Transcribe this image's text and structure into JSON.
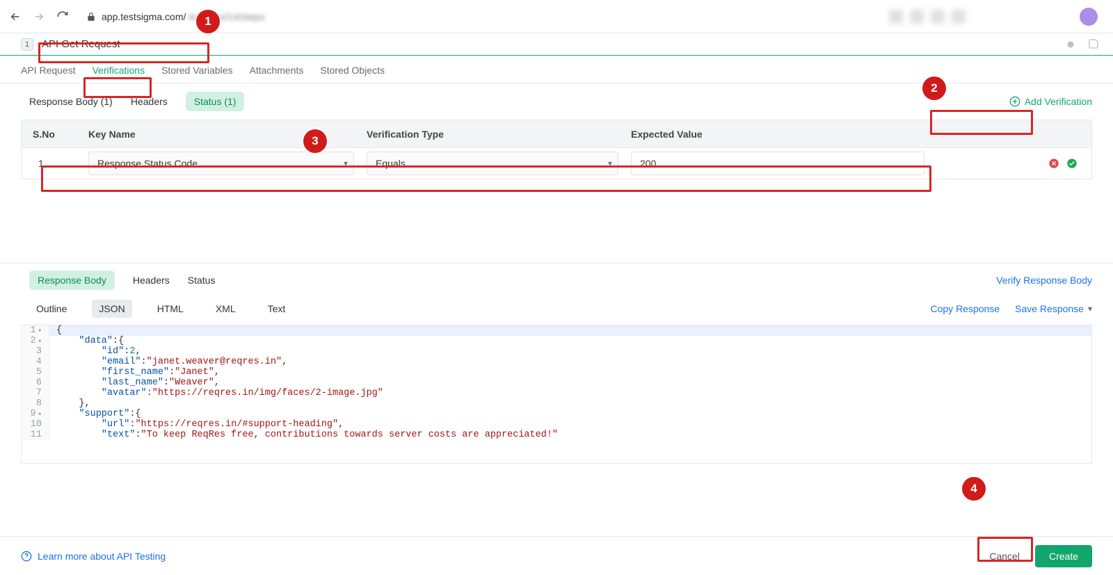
{
  "browser": {
    "url_host": "app.testsigma.com/",
    "url_rest": "..."
  },
  "title": {
    "number": "1",
    "value": "API Get Request"
  },
  "main_tabs": {
    "api_request": "API Request",
    "verifications": "Verifications",
    "stored_variables": "Stored Variables",
    "attachments": "Attachments",
    "stored_objects": "Stored Objects"
  },
  "sub_tabs": {
    "response_body": "Response Body (1)",
    "headers": "Headers",
    "status": "Status (1)"
  },
  "add_verification_label": "Add Verification",
  "table": {
    "headers": {
      "sno": "S.No",
      "key_name": "Key Name",
      "verification_type": "Verification Type",
      "expected_value": "Expected Value"
    },
    "row": {
      "sno": "1",
      "key_name": "Response Status Code",
      "verification_type": "Equals",
      "expected_value": "200"
    }
  },
  "response_tabs": {
    "response_body": "Response Body",
    "headers": "Headers",
    "status": "Status",
    "verify_response_body": "Verify Response Body"
  },
  "format_tabs": {
    "outline": "Outline",
    "json": "JSON",
    "html": "HTML",
    "xml": "XML",
    "text": "Text",
    "copy_response": "Copy Response",
    "save_response": "Save Response"
  },
  "code": {
    "l1": "{",
    "l2_key": "\"data\"",
    "l2_rest": ":{",
    "l3_key": "\"id\"",
    "l3_val": "2",
    "l3_end": ",",
    "l4_key": "\"email\"",
    "l4_val": "\"janet.weaver@reqres.in\"",
    "l4_end": ",",
    "l5_key": "\"first_name\"",
    "l5_val": "\"Janet\"",
    "l5_end": ",",
    "l6_key": "\"last_name\"",
    "l6_val": "\"Weaver\"",
    "l6_end": ",",
    "l7_key": "\"avatar\"",
    "l7_val": "\"https://reqres.in/img/faces/2-image.jpg\"",
    "l8": "},",
    "l9_key": "\"support\"",
    "l9_rest": ":{",
    "l10_key": "\"url\"",
    "l10_val": "\"https://reqres.in/#support-heading\"",
    "l10_end": ",",
    "l11_key": "\"text\"",
    "l11_val": "\"To keep ReqRes free, contributions towards server costs are appreciated!\""
  },
  "footer": {
    "learn": "Learn more about API Testing",
    "cancel": "Cancel",
    "create": "Create"
  },
  "callouts": {
    "c1": "1",
    "c2": "2",
    "c3": "3",
    "c4": "4"
  }
}
